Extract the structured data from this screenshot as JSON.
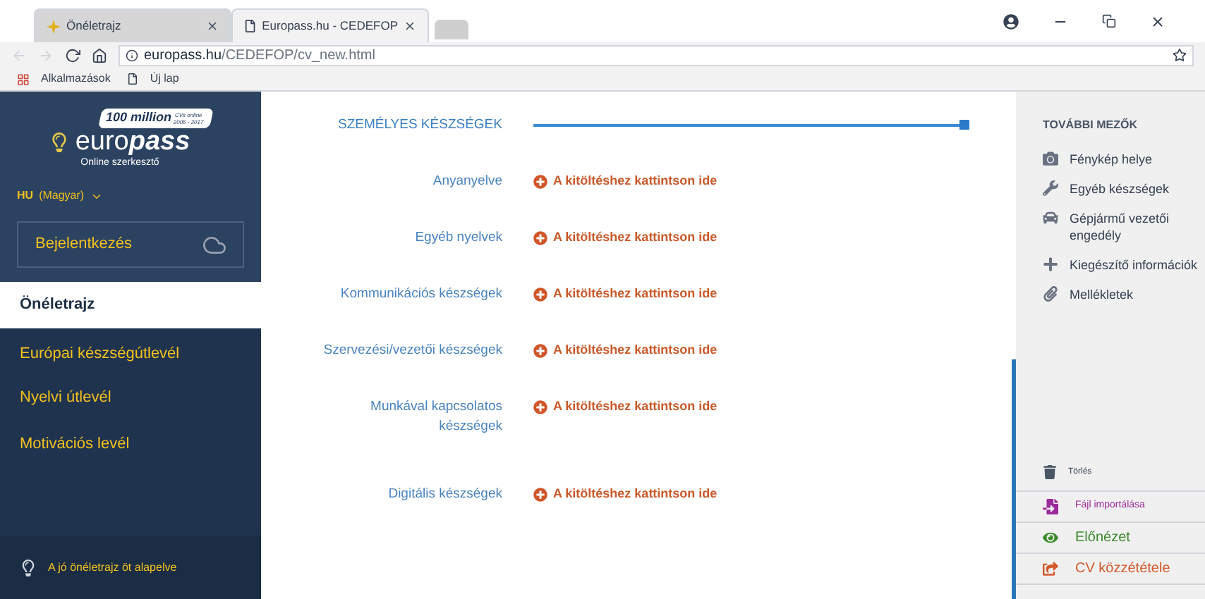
{
  "browser": {
    "tabs": [
      {
        "title": "Önéletrajz",
        "selected": false
      },
      {
        "title": "Europass.hu - CEDEFOP",
        "selected": true
      }
    ],
    "url_host": "europass.hu",
    "url_path": "/CEDEFOP/cv_new.html",
    "bookmarks": [
      "Alkalmazások",
      "Új lap"
    ]
  },
  "logo": {
    "badge": "100 million",
    "badge_small": "CVs online 2005 - 2017",
    "name_light": "euro",
    "name_bold": "pass",
    "subtitle": "Online szerkesztő"
  },
  "language": {
    "code": "HU",
    "name": "(Magyar)"
  },
  "login_button": "Bejelentkezés",
  "nav": [
    {
      "label": "Önéletrajz",
      "selected": true
    },
    {
      "label": "Európai készségútlevél",
      "selected": false
    },
    {
      "label": "Nyelvi útlevél",
      "selected": false
    },
    {
      "label": "Motivációs levél",
      "selected": false
    }
  ],
  "footer_link": "A jó önéletrajz öt alapelve",
  "section": {
    "title": "SZEMÉLYES KÉSZSÉGEK",
    "rows": [
      {
        "label": "Anyanyelve",
        "action": "A kitöltéshez kattintson ide"
      },
      {
        "label": "Egyéb nyelvek",
        "action": "A kitöltéshez kattintson ide"
      },
      {
        "label": "Kommunikációs készségek",
        "action": "A kitöltéshez kattintson ide"
      },
      {
        "label": "Szervezési/vezetői készségek",
        "action": "A kitöltéshez kattintson ide"
      },
      {
        "label": "Munkával kapcsolatos készségek",
        "action": "A kitöltéshez kattintson ide"
      },
      {
        "label": "Digitális készségek",
        "action": "A kitöltéshez kattintson ide"
      }
    ]
  },
  "right_panel": {
    "title": "TOVÁBBI MEZŐK",
    "items": [
      {
        "kind": "photo",
        "label": "Fénykép helye"
      },
      {
        "kind": "wrench",
        "label": "Egyéb készségek"
      },
      {
        "kind": "car",
        "label": "Gépjármű vezetői engedély"
      },
      {
        "kind": "plus",
        "label": "Kiegészítő információk"
      },
      {
        "kind": "clip",
        "label": "Mellékletek"
      }
    ],
    "delete": "Törlés",
    "actions": [
      {
        "kind": "import",
        "label": "Fájl importálása",
        "color": "#9b2a9b"
      },
      {
        "kind": "preview",
        "label": "Előnézet",
        "color": "#3c8a2e"
      },
      {
        "kind": "publish",
        "label": "CV közzététele",
        "color": "#d3582b"
      }
    ]
  }
}
